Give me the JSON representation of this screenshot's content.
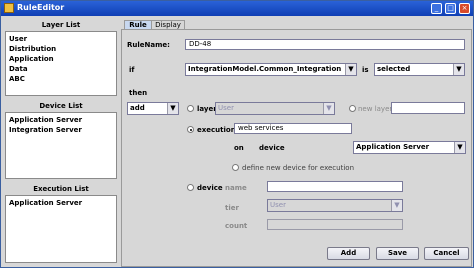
{
  "window": {
    "title": "RuleEditor"
  },
  "layer_list": {
    "header": "Layer List",
    "items": [
      "User",
      "Distribution",
      "Application",
      "Data",
      "ABC"
    ]
  },
  "device_list": {
    "header": "Device List",
    "items": [
      "Application Server",
      "Integration Server"
    ]
  },
  "execution_list": {
    "header": "Execution List",
    "items": [
      "Application Server"
    ]
  },
  "tabs": [
    "Rule",
    "Display"
  ],
  "form": {
    "rule_name_label": "RuleName:",
    "rule_name_value": "DD-48",
    "if_label": "if",
    "if_value": "IntegrationModel.Common_Integration",
    "is_label": "is",
    "is_value": "selected",
    "then_label": "then",
    "action_value": "add",
    "layer_label": "layer",
    "layer_value": "User",
    "new_layer_label": "new layer",
    "new_layer_value": "",
    "execution_label": "execution",
    "execution_value": "web services",
    "on_label": "on",
    "device_label": "device",
    "device_value": "Application Server",
    "define_new_device_label": "define new device for execution",
    "device_option_label": "device",
    "name_label": "name",
    "name_value": "",
    "tier_label": "tier",
    "tier_value": "User",
    "count_label": "count",
    "count_value": ""
  },
  "buttons": {
    "add": "Add",
    "save": "Save",
    "cancel": "Cancel"
  }
}
